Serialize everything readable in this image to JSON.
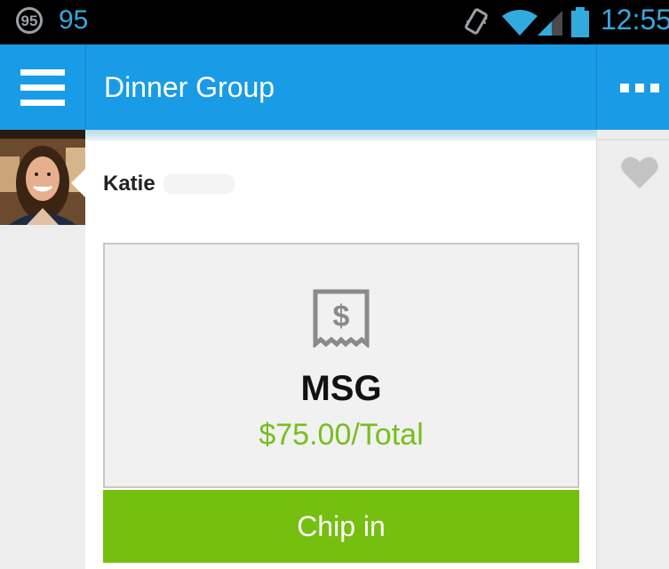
{
  "status_bar": {
    "notification_badge": "95",
    "notification_count": "95",
    "time": "12:55",
    "icons": [
      "vibrate-icon",
      "wifi-icon",
      "signal-icon",
      "battery-icon"
    ]
  },
  "action_bar": {
    "title": "Dinner Group",
    "menu_icon": "hamburger-menu-icon",
    "overflow_icon": "overflow-menu-icon"
  },
  "post": {
    "author": "Katie",
    "icon": "receipt-dollar-icon",
    "bill_title": "MSG",
    "bill_amount": "$75.00/Total",
    "action_label": "Chip in",
    "like_icon": "heart-icon"
  },
  "colors": {
    "action_bar": "#1a9be6",
    "accent_green": "#75bf0f",
    "amount_green": "#78be1e",
    "status_blue": "#33aadd"
  }
}
